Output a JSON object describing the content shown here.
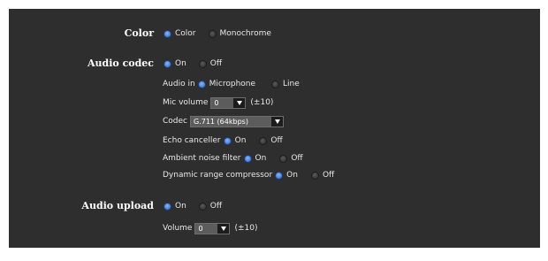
{
  "color": {
    "label": "Color",
    "options": [
      "Color",
      "Monochrome"
    ],
    "selected": "Color"
  },
  "audio_codec": {
    "label": "Audio codec",
    "options": [
      "On",
      "Off"
    ],
    "selected": "On",
    "audio_in": {
      "label": "Audio in",
      "options": [
        "Microphone",
        "Line"
      ],
      "selected": "Microphone"
    },
    "mic_volume": {
      "label": "Mic volume",
      "value": "0",
      "range": "(±10)"
    },
    "codec": {
      "label": "Codec",
      "value": "G.711 (64kbps)"
    },
    "echo_canceller": {
      "label": "Echo canceller",
      "options": [
        "On",
        "Off"
      ],
      "selected": "On"
    },
    "ambient_noise_filter": {
      "label": "Ambient noise filter",
      "options": [
        "On",
        "Off"
      ],
      "selected": "On"
    },
    "dynamic_range_compressor": {
      "label": "Dynamic range compressor",
      "options": [
        "On",
        "Off"
      ],
      "selected": "On"
    }
  },
  "audio_upload": {
    "label": "Audio upload",
    "options": [
      "On",
      "Off"
    ],
    "selected": "On",
    "volume": {
      "label": "Volume",
      "value": "0",
      "range": "(±10)"
    }
  },
  "colors": {
    "panel_bg": "#2e2e2e",
    "radio_on": "#4f86de",
    "radio_off": "#3c3c3c"
  }
}
